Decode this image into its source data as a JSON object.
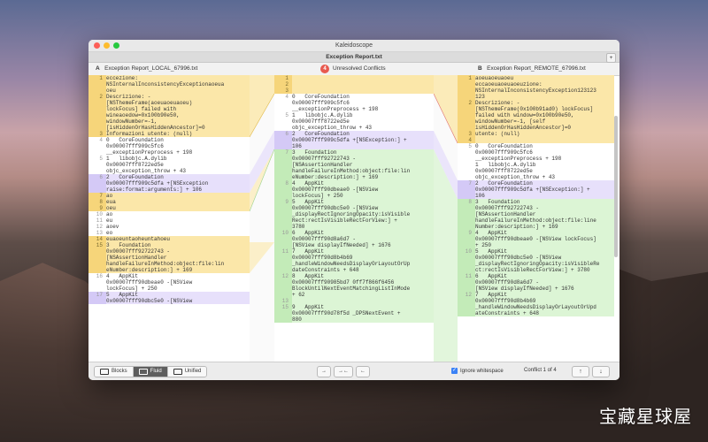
{
  "window": {
    "title": "Kaleidoscope",
    "tab": "Exception Report.txt",
    "tab_add": "+"
  },
  "files": {
    "a_label": "A",
    "a_name": "Exception Report_LOCAL_67996.txt",
    "b_label": "B",
    "b_name": "Exception Report_REMOTE_67996.txt",
    "conflict_count": "4",
    "conflict_text": "Unresolved Conflicts"
  },
  "pane_a": [
    {
      "n": "1",
      "t": "eccezione:",
      "c": "y"
    },
    {
      "n": "",
      "t": "NSInternalInconsistencyExceptionaoeua",
      "c": "y"
    },
    {
      "n": "",
      "t": "oeu",
      "c": "y"
    },
    {
      "n": "2",
      "t": "Descrizione: -",
      "c": "y"
    },
    {
      "n": "",
      "t": "[NSThemeFrame(aoeuaoeuaoeu)",
      "c": "y"
    },
    {
      "n": "",
      "t": "lockFocus] failed with",
      "c": "y"
    },
    {
      "n": "",
      "t": "wineaoedow=0x100b90e50,",
      "c": "y"
    },
    {
      "n": "",
      "t": "windowNumber=-1,",
      "c": "y"
    },
    {
      "n": "",
      "t": "[isHiddenOrHasHiddenAncestor]=0",
      "c": "y"
    },
    {
      "n": "3",
      "t": "Informazioni utente: (null)",
      "c": "y"
    },
    {
      "n": "4",
      "t": "0   CoreFoundation",
      "c": "e"
    },
    {
      "n": "",
      "t": "0x00007fff909c5fc6",
      "c": "e"
    },
    {
      "n": "",
      "t": "__exceptionPreprocess + 198",
      "c": "e"
    },
    {
      "n": "5",
      "t": "1   libobjc.A.dylib",
      "c": "e"
    },
    {
      "n": "",
      "t": "0x00007fff8722ed5e",
      "c": "e"
    },
    {
      "n": "",
      "t": "objc_exception_throw + 43",
      "c": "e"
    },
    {
      "n": "6",
      "t": "2   CoreFoundation",
      "c": "p"
    },
    {
      "n": "",
      "t": "0x00007fff909c5dfa +[NSException",
      "c": "p"
    },
    {
      "n": "",
      "t": "raise:format:arguments:] + 106",
      "c": "p"
    },
    {
      "n": "7",
      "t": "ao",
      "c": "y"
    },
    {
      "n": "8",
      "t": "eua",
      "c": "y"
    },
    {
      "n": "9",
      "t": "oeu",
      "c": "y"
    },
    {
      "n": "10",
      "t": "ao",
      "c": "e"
    },
    {
      "n": "11",
      "t": "eu",
      "c": "e"
    },
    {
      "n": "12",
      "t": "aoev",
      "c": "e"
    },
    {
      "n": "13",
      "t": "eo",
      "c": "e"
    },
    {
      "n": "14",
      "t": "euaoeuntaoheuntahoeu",
      "c": "y"
    },
    {
      "n": "15",
      "t": "3   Foundation",
      "c": "y"
    },
    {
      "n": "",
      "t": "0x00007fff92722743 -",
      "c": "y"
    },
    {
      "n": "",
      "t": "[NSAssertionHandler",
      "c": "y"
    },
    {
      "n": "",
      "t": "handleFailureInMethod:object:file:lin",
      "c": "y"
    },
    {
      "n": "",
      "t": "eNumber:description:] + 169",
      "c": "y"
    },
    {
      "n": "16",
      "t": "4   AppKit",
      "c": "e"
    },
    {
      "n": "",
      "t": "0x00007fff90dbeae0 -[NSView",
      "c": "e"
    },
    {
      "n": "",
      "t": "lockFocus] + 250",
      "c": "e"
    },
    {
      "n": "17",
      "t": "5   AppKit",
      "c": "p"
    },
    {
      "n": "",
      "t": "0x00007fff90dbc5e0 -[NSView",
      "c": "p"
    }
  ],
  "pane_m": [
    {
      "n": "1",
      "t": "",
      "c": "y"
    },
    {
      "n": "2",
      "t": "",
      "c": "y"
    },
    {
      "n": "3",
      "t": "",
      "c": "y"
    },
    {
      "n": "4",
      "t": "0   CoreFoundation",
      "c": "e"
    },
    {
      "n": "",
      "t": "0x00007fff909c5fc6",
      "c": "e"
    },
    {
      "n": "",
      "t": "__exceptionPreprocess + 198",
      "c": "e"
    },
    {
      "n": "5",
      "t": "1   libobjc.A.dylib",
      "c": "e"
    },
    {
      "n": "",
      "t": "0x00007fff8722ed5e",
      "c": "e"
    },
    {
      "n": "",
      "t": "objc_exception_throw + 43",
      "c": "e"
    },
    {
      "n": "6",
      "t": "2   CoreFoundation",
      "c": "p"
    },
    {
      "n": "",
      "t": "0x00007fff909c5dfa +[NSException:] +",
      "c": "p"
    },
    {
      "n": "",
      "t": "106",
      "c": "p"
    },
    {
      "n": "7",
      "t": "3   Foundation",
      "c": "g"
    },
    {
      "n": "",
      "t": "0x00007fff92722743 -",
      "c": "g"
    },
    {
      "n": "",
      "t": "[NSAssertionHandler",
      "c": "g"
    },
    {
      "n": "",
      "t": "handleFailureInMethod:object:file:lin",
      "c": "g"
    },
    {
      "n": "",
      "t": "eNumber:description:] + 169",
      "c": "g"
    },
    {
      "n": "8",
      "t": "4   AppKit",
      "c": "g"
    },
    {
      "n": "",
      "t": "0x00007fff90dbeae0 -[NSView",
      "c": "g"
    },
    {
      "n": "",
      "t": "lockFocus] + 250",
      "c": "g"
    },
    {
      "n": "9",
      "t": "5   AppKit",
      "c": "g"
    },
    {
      "n": "",
      "t": "0x00007fff90dbc5e0 -[NSView",
      "c": "g"
    },
    {
      "n": "",
      "t": "_displayRectIgnoringOpacity:isVisible",
      "c": "g"
    },
    {
      "n": "",
      "t": "Rect:rectIsVisibleRectForView:] +",
      "c": "g"
    },
    {
      "n": "",
      "t": "3780",
      "c": "g"
    },
    {
      "n": "10",
      "t": "6   AppKit",
      "c": "g"
    },
    {
      "n": "",
      "t": "0x00007fff90d8a6d7 -",
      "c": "g"
    },
    {
      "n": "",
      "t": "[NSView displayIfNeeded] + 1676",
      "c": "g"
    },
    {
      "n": "11",
      "t": "7   AppKit",
      "c": "g"
    },
    {
      "n": "",
      "t": "0x00007fff90d8b4b69",
      "c": "g"
    },
    {
      "n": "",
      "t": "_handleWindowNeedsDisplayOrLayoutOrUp",
      "c": "g"
    },
    {
      "n": "",
      "t": "dateConstraints + 648",
      "c": "g"
    },
    {
      "n": "12",
      "t": "8   AppKit",
      "c": "g"
    },
    {
      "n": "",
      "t": "0x00007fff90985bd7 0ff7f866f6456",
      "c": "g"
    },
    {
      "n": "",
      "t": "BlockUntilNextEventMatchingListInMode",
      "c": "g"
    },
    {
      "n": "",
      "t": "+ 62",
      "c": "g"
    },
    {
      "n": "13",
      "t": "",
      "c": "g"
    },
    {
      "n": "",
      "t": "",
      "c": "g"
    },
    {
      "n": "15",
      "t": "9   AppKit",
      "c": "g"
    },
    {
      "n": "",
      "t": "0x00007fff90d78f5d _DPSNextEvent +",
      "c": "g"
    },
    {
      "n": "",
      "t": "880",
      "c": "g"
    }
  ],
  "pane_b": [
    {
      "n": "1",
      "t": "aoeuaoeuaoeu",
      "c": "y"
    },
    {
      "n": "",
      "t": "eccaoeuaoeuaoeuzione:",
      "c": "y"
    },
    {
      "n": "",
      "t": "NSInternalInconsistencyException123123",
      "c": "y"
    },
    {
      "n": "",
      "t": "123",
      "c": "y"
    },
    {
      "n": "2",
      "t": "Descrizione: -",
      "c": "y"
    },
    {
      "n": "",
      "t": "[NSThemeFrame(0x100b91ad0) lockFocus]",
      "c": "y"
    },
    {
      "n": "",
      "t": "failed with window=0x100b90e50,",
      "c": "y"
    },
    {
      "n": "",
      "t": "windowNumber=-1, [self",
      "c": "y"
    },
    {
      "n": "",
      "t": "isHiddenOrHasHiddenAncestor]=0",
      "c": "y"
    },
    {
      "n": "3",
      "t": "utente: (null)",
      "c": "y"
    },
    {
      "n": "4",
      "t": "",
      "c": "y"
    },
    {
      "n": "5",
      "t": "0   CoreFoundation",
      "c": "e"
    },
    {
      "n": "",
      "t": "0x00007fff909c5fc6",
      "c": "e"
    },
    {
      "n": "",
      "t": "__exceptionPreprocess + 198",
      "c": "e"
    },
    {
      "n": "",
      "t": "1   libobjc.A.dylib",
      "c": "e"
    },
    {
      "n": "",
      "t": "0x00007fff8722ed5e",
      "c": "e"
    },
    {
      "n": "",
      "t": "objc_exception_throw + 43",
      "c": "e"
    },
    {
      "n": "7",
      "t": "2   CoreFoundation",
      "c": "p"
    },
    {
      "n": "",
      "t": "0x00007fff909c5dfa +[NSException:] +",
      "c": "p"
    },
    {
      "n": "",
      "t": "106",
      "c": "p"
    },
    {
      "n": "8",
      "t": "3   Foundation",
      "c": "g"
    },
    {
      "n": "",
      "t": "0x00007fff92722743 -",
      "c": "g"
    },
    {
      "n": "",
      "t": "[NSAssertionHandler",
      "c": "g"
    },
    {
      "n": "",
      "t": "handleFailureInMethod:object:file:line",
      "c": "g"
    },
    {
      "n": "",
      "t": "Number:description:] + 169",
      "c": "g"
    },
    {
      "n": "9",
      "t": "4   AppKit",
      "c": "g"
    },
    {
      "n": "",
      "t": "0x00007fff90dbeae0 -[NSView lockFocus]",
      "c": "g"
    },
    {
      "n": "",
      "t": "+ 250",
      "c": "g"
    },
    {
      "n": "10",
      "t": "5   AppKit",
      "c": "g"
    },
    {
      "n": "",
      "t": "0x00007fff90dbc5e0 -[NSView",
      "c": "g"
    },
    {
      "n": "",
      "t": "_displayRectIgnoringOpacity:isVisibleRe",
      "c": "g"
    },
    {
      "n": "",
      "t": "ct:rectIsVisibleRectForView:] + 3780",
      "c": "g"
    },
    {
      "n": "11",
      "t": "6   AppKit",
      "c": "g"
    },
    {
      "n": "",
      "t": "0x00007fff90d8a6d7 -",
      "c": "g"
    },
    {
      "n": "",
      "t": "[NSView displayIfNeeded] + 1676",
      "c": "g"
    },
    {
      "n": "12",
      "t": "7   AppKit",
      "c": "g"
    },
    {
      "n": "",
      "t": "0x00007fff90d8b4b69",
      "c": "g"
    },
    {
      "n": "",
      "t": "_handleWindowNeedsDisplayOrLayoutOrUpd",
      "c": "g"
    },
    {
      "n": "",
      "t": "ateConstraints + 648",
      "c": "g"
    }
  ],
  "bottombar": {
    "blocks": "Blocks",
    "fluid": "Fluid",
    "unified": "Unified",
    "merge_left": "→",
    "merge_left_b": "→←",
    "merge_right": "←",
    "ignore_whitespace": "Ignore whitespace",
    "conflict_status": "Conflict 1 of 4",
    "prev": "↑",
    "next": "↓"
  },
  "watermark": "宝藏星球屋",
  "colors": {
    "conflict_yellow": "#fbe7a9",
    "added_green": "#dcf5d5",
    "changed_purple": "#e7e0fb",
    "badge": "#e85a4f"
  }
}
